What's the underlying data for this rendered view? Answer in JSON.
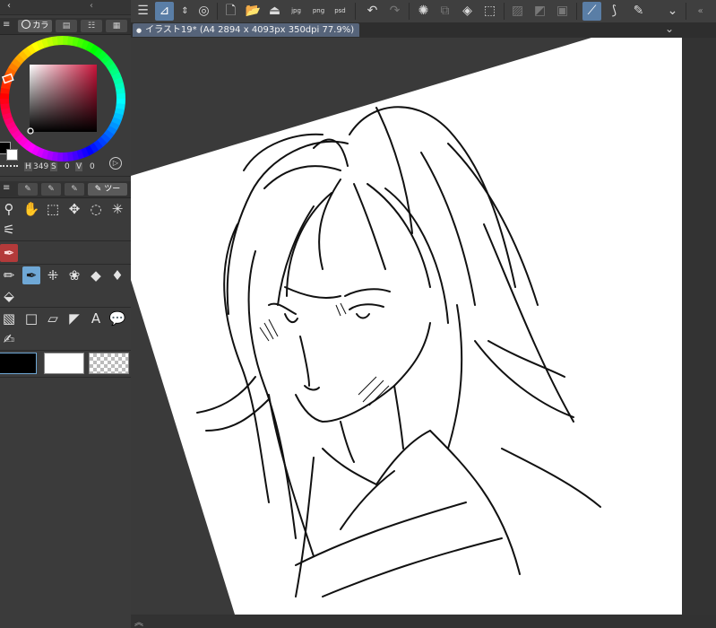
{
  "document": {
    "tab_title": "イラスト19* (A4 2894 x 4093px 350dpi 77.9%)"
  },
  "left_panel": {
    "color_tab_label": "カラ",
    "tool_tab_label": "ツー",
    "hsv": {
      "h_label": "H",
      "h_value": "349",
      "s_label": "S",
      "s_value": "0",
      "v_label": "V",
      "v_value": "0"
    }
  },
  "colors": {
    "main_color": "#000000",
    "sub_color": "#ffffff",
    "accent": "#6fa8d6",
    "selected_tab": "#56647a"
  },
  "toolbar_icons": [
    "menu-icon",
    "canvas-icon",
    "updown-icon",
    "record-icon",
    "new-icon",
    "open-icon",
    "save-icon",
    "export-jpg-icon",
    "export-png-icon",
    "export-psd-icon",
    "undo-icon",
    "redo-icon",
    "loading-icon",
    "transform-icon",
    "fill-icon",
    "crop-icon",
    "mask-icon",
    "gradient-icon",
    "frame-icon",
    "stabilize-icon",
    "curve-icon",
    "pen-pressure-icon",
    "collapse-icon"
  ],
  "export_labels": {
    "jpg": "jpg",
    "png": "png",
    "psd": "psd"
  }
}
